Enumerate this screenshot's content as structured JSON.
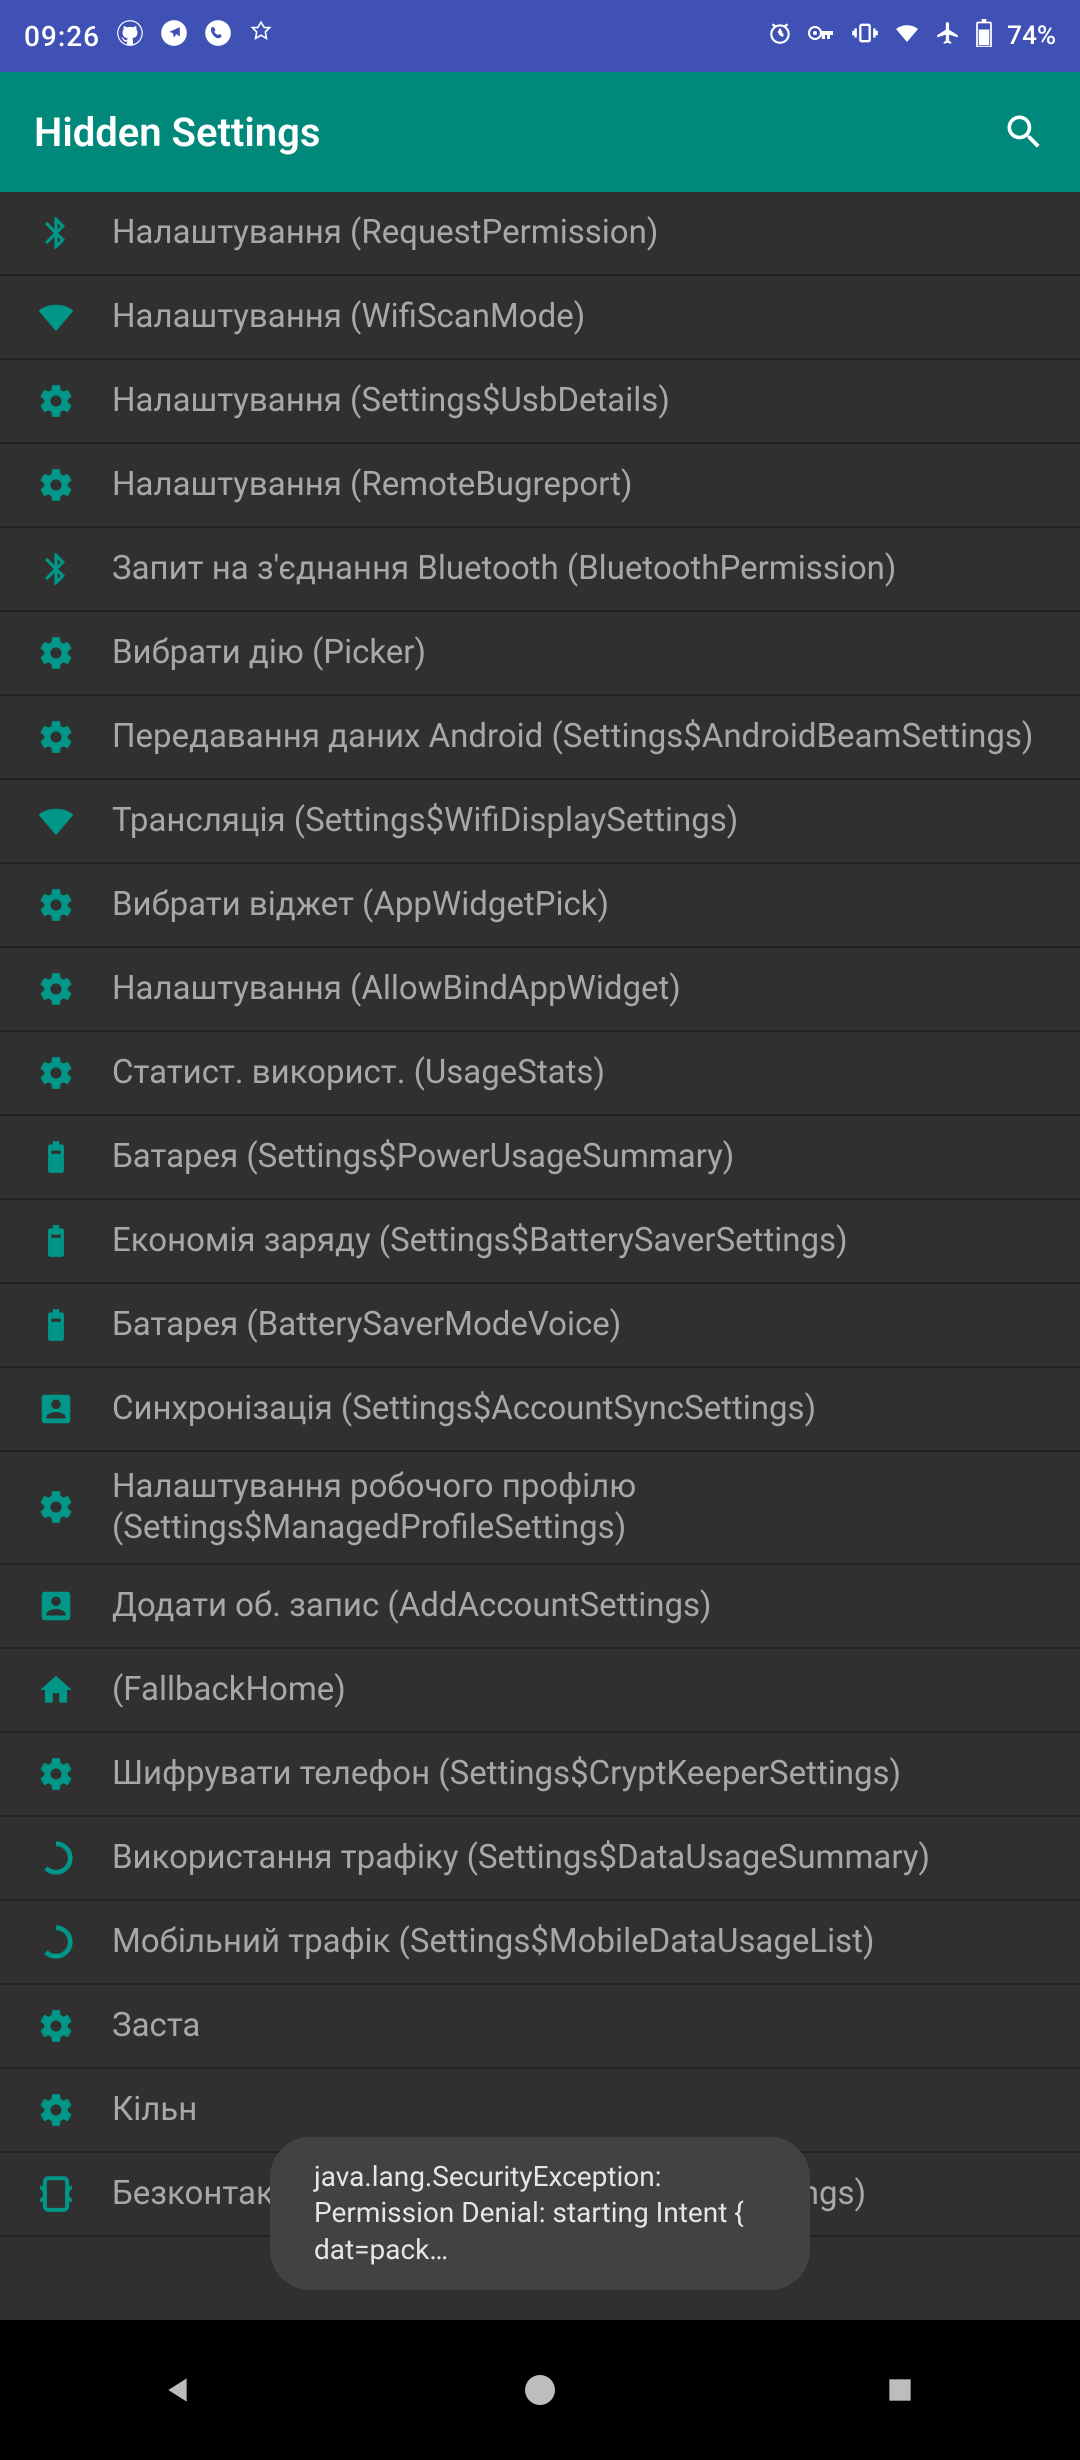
{
  "status": {
    "time": "09:26",
    "battery": "74%"
  },
  "app": {
    "title": "Hidden Settings"
  },
  "items": [
    {
      "icon": "bluetooth",
      "label": "Налаштування (RequestPermission)"
    },
    {
      "icon": "wifi",
      "label": "Налаштування (WifiScanMode)"
    },
    {
      "icon": "gear",
      "label": "Налаштування (Settings$UsbDetails)"
    },
    {
      "icon": "gear",
      "label": "Налаштування (RemoteBugreport)"
    },
    {
      "icon": "bluetooth",
      "label": "Запит на з'єднання Bluetooth (BluetoothPermission)"
    },
    {
      "icon": "gear",
      "label": "Вибрати дію (Picker)"
    },
    {
      "icon": "gear",
      "label": "Передавання даних Android (Settings$AndroidBeamSettings)"
    },
    {
      "icon": "wifi",
      "label": "Трансляція (Settings$WifiDisplaySettings)"
    },
    {
      "icon": "gear",
      "label": "Вибрати віджет (AppWidgetPick)"
    },
    {
      "icon": "gear",
      "label": "Налаштування (AllowBindAppWidget)"
    },
    {
      "icon": "gear",
      "label": "Статист. використ. (UsageStats)"
    },
    {
      "icon": "battery",
      "label": "Батарея (Settings$PowerUsageSummary)"
    },
    {
      "icon": "battery",
      "label": "Економія заряду (Settings$BatterySaverSettings)"
    },
    {
      "icon": "battery",
      "label": "Батарея (BatterySaverModeVoice)"
    },
    {
      "icon": "account",
      "label": "Синхронізація (Settings$AccountSyncSettings)"
    },
    {
      "icon": "gear",
      "label": "Налаштування робочого профілю (Settings$ManagedProfileSettings)"
    },
    {
      "icon": "account",
      "label": "Додати об. запис (AddAccountSettings)"
    },
    {
      "icon": "home",
      "label": " (FallbackHome)"
    },
    {
      "icon": "gear",
      "label": "Шифрувати телефон (Settings$CryptKeeperSettings)"
    },
    {
      "icon": "data",
      "label": "Використання трафіку (Settings$DataUsageSummary)"
    },
    {
      "icon": "data",
      "label": "Мобільний трафік (Settings$MobileDataUsageList)"
    },
    {
      "icon": "gear",
      "label": "Заста"
    },
    {
      "icon": "gear",
      "label": "Кільн"
    },
    {
      "icon": "nfc",
      "label": "Безконтактні платежі (Settings$PaymentSettings)"
    }
  ],
  "toast": {
    "line1": "java.lang.SecurityException:",
    "line2": "Permission Denial: starting Intent { dat=pack…"
  }
}
